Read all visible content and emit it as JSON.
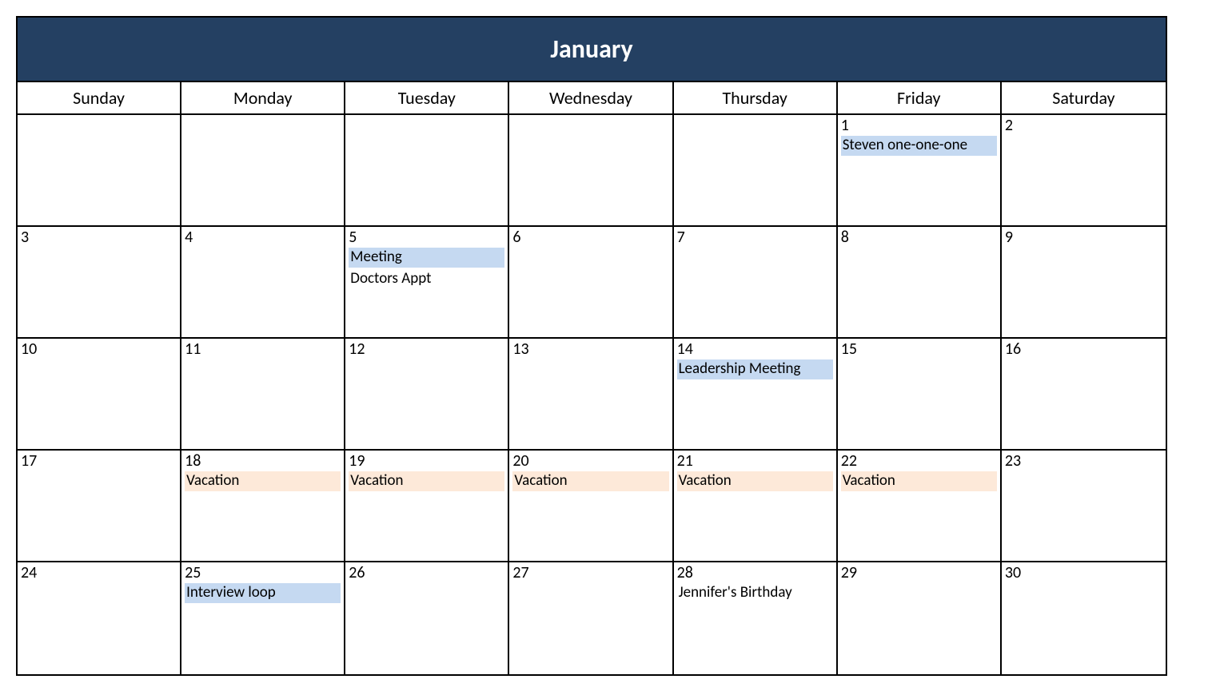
{
  "month_title": "January",
  "day_names": [
    "Sunday",
    "Monday",
    "Tuesday",
    "Wednesday",
    "Thursday",
    "Friday",
    "Saturday"
  ],
  "colors": {
    "header_bg": "#244062",
    "event_blue": "#c5d9f1",
    "event_peach": "#fde9d9"
  },
  "weeks": [
    [
      {
        "num": "",
        "events": []
      },
      {
        "num": "",
        "events": []
      },
      {
        "num": "",
        "events": []
      },
      {
        "num": "",
        "events": []
      },
      {
        "num": "",
        "events": []
      },
      {
        "num": "1",
        "events": [
          {
            "label": "Steven one-one-one",
            "style": "blue"
          }
        ]
      },
      {
        "num": "2",
        "events": []
      }
    ],
    [
      {
        "num": "3",
        "events": []
      },
      {
        "num": "4",
        "events": []
      },
      {
        "num": "5",
        "events": [
          {
            "label": "Meeting",
            "style": "blue"
          },
          {
            "label": "Doctors Appt",
            "style": "plain"
          }
        ]
      },
      {
        "num": "6",
        "events": []
      },
      {
        "num": "7",
        "events": []
      },
      {
        "num": "8",
        "events": []
      },
      {
        "num": "9",
        "events": []
      }
    ],
    [
      {
        "num": "10",
        "events": []
      },
      {
        "num": "11",
        "events": []
      },
      {
        "num": "12",
        "events": []
      },
      {
        "num": "13",
        "events": []
      },
      {
        "num": "14",
        "events": [
          {
            "label": "Leadership Meeting",
            "style": "blue"
          }
        ]
      },
      {
        "num": "15",
        "events": []
      },
      {
        "num": "16",
        "events": []
      }
    ],
    [
      {
        "num": "17",
        "events": []
      },
      {
        "num": "18",
        "events": [
          {
            "label": "Vacation",
            "style": "peach"
          }
        ]
      },
      {
        "num": "19",
        "events": [
          {
            "label": "Vacation",
            "style": "peach"
          }
        ]
      },
      {
        "num": "20",
        "events": [
          {
            "label": "Vacation",
            "style": "peach"
          }
        ]
      },
      {
        "num": "21",
        "events": [
          {
            "label": "Vacation",
            "style": "peach"
          }
        ]
      },
      {
        "num": "22",
        "events": [
          {
            "label": "Vacation",
            "style": "peach"
          }
        ]
      },
      {
        "num": "23",
        "events": []
      }
    ],
    [
      {
        "num": "24",
        "events": []
      },
      {
        "num": "25",
        "events": [
          {
            "label": "Interview loop",
            "style": "blue"
          }
        ]
      },
      {
        "num": "26",
        "events": []
      },
      {
        "num": "27",
        "events": []
      },
      {
        "num": "28",
        "events": [
          {
            "label": "Jennifer's Birthday",
            "style": "plain"
          }
        ]
      },
      {
        "num": "29",
        "events": []
      },
      {
        "num": "30",
        "events": []
      }
    ]
  ]
}
